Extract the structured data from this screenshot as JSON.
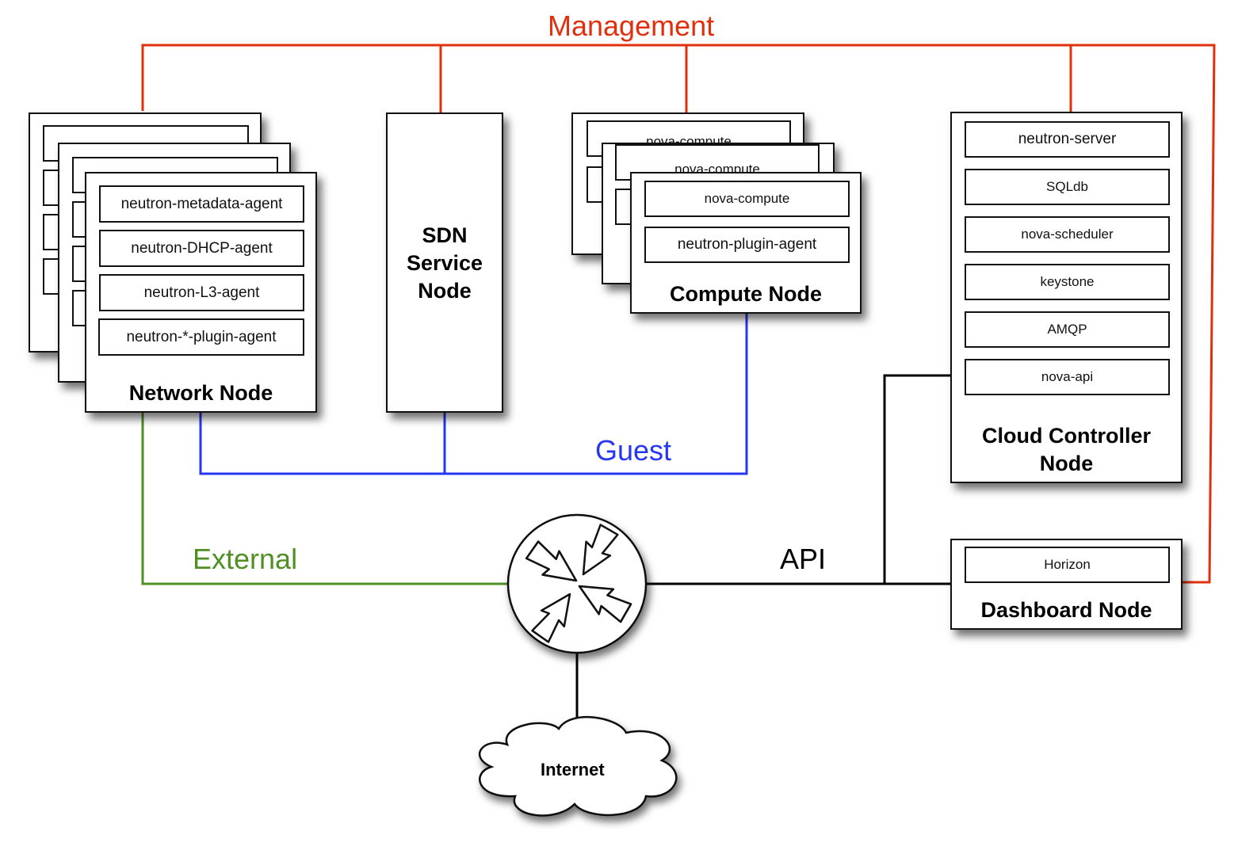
{
  "colors": {
    "management": "#e1300e",
    "guest": "#2637f2",
    "external": "#4f8f23",
    "api": "#000000"
  },
  "networks": {
    "management": "Management",
    "guest": "Guest",
    "external": "External",
    "api": "API"
  },
  "network_node": {
    "title": "Network Node",
    "services": [
      "neutron-metadata-agent",
      "neutron-DHCP-agent",
      "neutron-L3-agent",
      "neutron-*-plugin-agent"
    ],
    "stacked_copies": 3
  },
  "sdn_node": {
    "title": "SDN Service Node"
  },
  "compute_node": {
    "title": "Compute Node",
    "services": [
      "nova-compute",
      "neutron-plugin-agent"
    ],
    "stacked_copies": 3
  },
  "cloud_controller_node": {
    "title_line1": "Cloud Controller",
    "title_line2": "Node",
    "services": [
      "neutron-server",
      "SQLdb",
      "nova-scheduler",
      "keystone",
      "AMQP",
      "nova-api"
    ]
  },
  "dashboard_node": {
    "title": "Dashboard Node",
    "services": [
      "Horizon"
    ]
  },
  "router": {
    "icon": "router-icon"
  },
  "internet": {
    "label": "Internet"
  }
}
